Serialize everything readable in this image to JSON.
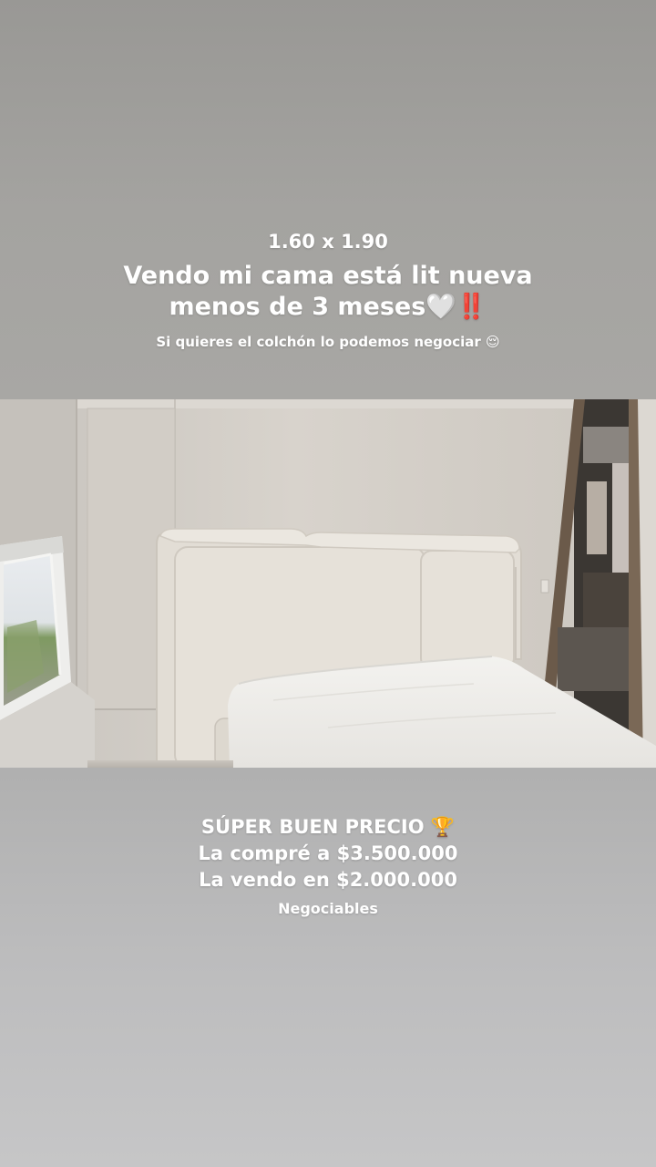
{
  "story": {
    "dimensions": "1.60 x 1.90",
    "headline": "Vendo mi cama está lit nueva menos de 3 meses",
    "headline_emojis": "🤍‼️",
    "subline": "Si quieres el colchón lo podemos negociar",
    "subline_emoji": "😌",
    "price_title": "SÚPER BUEN PRECIO",
    "price_title_emoji": "🏆",
    "bought_line": "La compré a $3.500.000",
    "selling_line": "La vendo en $2.000.000",
    "negotiable": "Negociables"
  },
  "photo": {
    "subject": "upholstered bed with white mattress",
    "colors": {
      "wall": "#d7d2cb",
      "headboard": "#e4dfd7",
      "mattress": "#f0efec",
      "closet": "#3a3530"
    }
  }
}
